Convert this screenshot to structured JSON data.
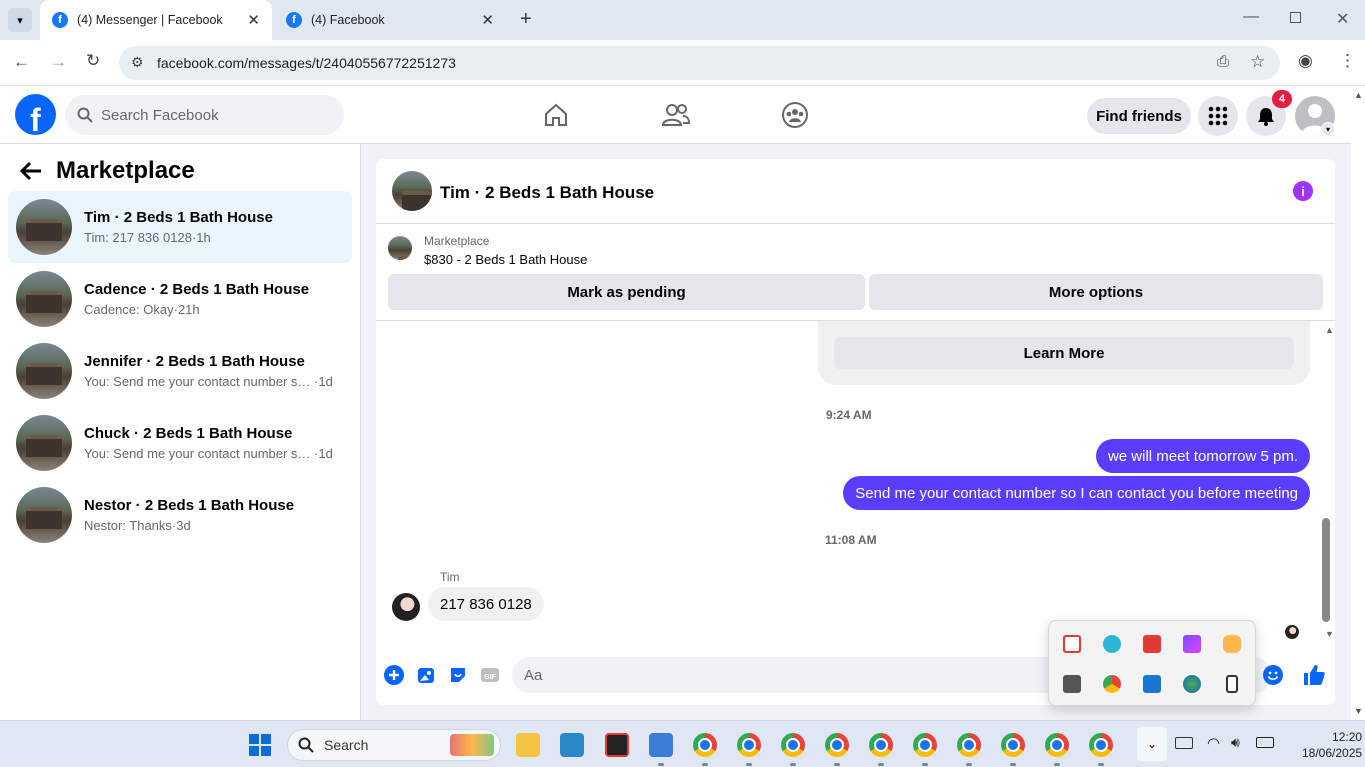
{
  "browser": {
    "tabs": [
      {
        "title": "(4) Messenger | Facebook",
        "active": true
      },
      {
        "title": "(4) Facebook",
        "active": false
      }
    ],
    "url": "facebook.com/messages/t/24040556772251273"
  },
  "fb": {
    "logo": "f",
    "search_placeholder": "Search Facebook",
    "nav_icons": [
      "home-icon",
      "friends-icon",
      "groups-icon"
    ],
    "find_friends_label": "Find friends",
    "notification_count": "4"
  },
  "sidebar": {
    "title": "Marketplace",
    "conversations": [
      {
        "name": "Tim · 2 Beds 1 Bath House",
        "preview": "Tim: 217 836 0128",
        "time": "1h",
        "selected": true
      },
      {
        "name": "Cadence · 2 Beds 1 Bath House",
        "preview": "Cadence: Okay",
        "time": "21h",
        "selected": false
      },
      {
        "name": "Jennifer · 2 Beds 1 Bath House",
        "preview": "You: Send me your contact number so...",
        "time": "1d",
        "selected": false
      },
      {
        "name": "Chuck · 2 Beds 1 Bath House",
        "preview": "You: Send me your contact number so...",
        "time": "1d",
        "selected": false
      },
      {
        "name": "Nestor · 2 Beds 1 Bath House",
        "preview": "Nestor: Thanks",
        "time": "3d",
        "selected": false
      }
    ]
  },
  "chat": {
    "title": "Tim · 2 Beds 1 Bath House",
    "marketplace_label": "Marketplace",
    "listing": "$830 - 2 Beds 1 Bath House",
    "mark_pending_label": "Mark as pending",
    "more_options_label": "More options",
    "learn_more_label": "Learn More",
    "timestamps": [
      "9:24 AM",
      "11:08 AM"
    ],
    "outgoing": [
      "we will meet tomorrow 5 pm.",
      "Send me your contact number so I can contact you before meeting"
    ],
    "incoming_sender": "Tim",
    "incoming_message": "217 836 0128",
    "composer_placeholder": "Aa"
  },
  "taskbar": {
    "search_label": "Search",
    "time": "12:20",
    "date": "18/06/2025"
  },
  "colors": {
    "fb_blue": "#0866ff",
    "outgoing_bubble": "#5b3dff",
    "selected_row": "#ebf5ff",
    "badge_red": "#e41e3f"
  }
}
